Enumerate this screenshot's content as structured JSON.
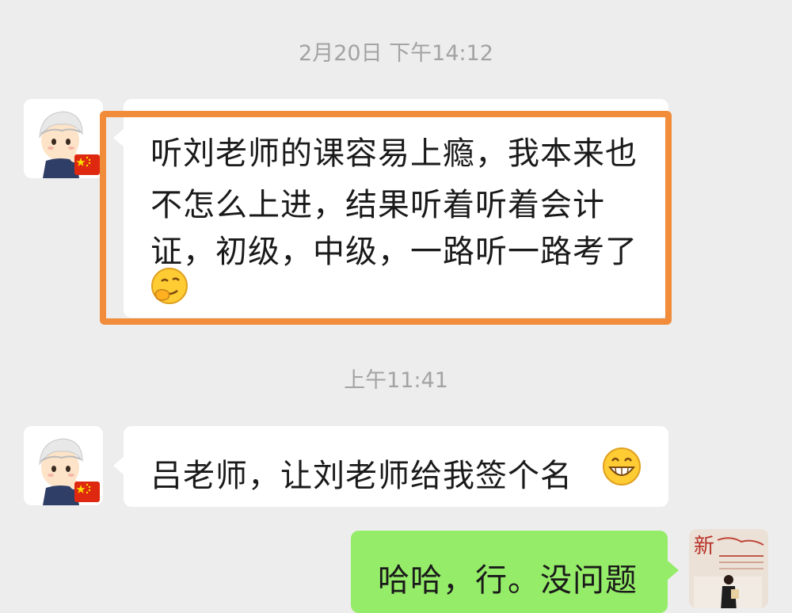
{
  "messages": [
    {
      "timestamp": "2月20日 下午14:12",
      "sender": "contact",
      "lines": [
        "听刘老师的课容易上瘾，我本来也",
        "不怎么上进，结果听着听着会计",
        "证，初级，中级，一路听一路考了"
      ],
      "emoji": "smirk-face-emoji",
      "highlighted": true
    },
    {
      "timestamp": "上午11:41",
      "sender": "contact",
      "text": "吕老师，让刘老师给我签个名",
      "emoji": "grin-face-emoji"
    },
    {
      "sender": "self",
      "text": "哈哈，行。没问题"
    }
  ],
  "avatar_photo_caption": "新",
  "colors": {
    "background": "#ededed",
    "incoming_bubble": "#ffffff",
    "outgoing_bubble": "#95ec69",
    "highlight": "#f08c3a",
    "timestamp_text": "#a3a3a3"
  }
}
